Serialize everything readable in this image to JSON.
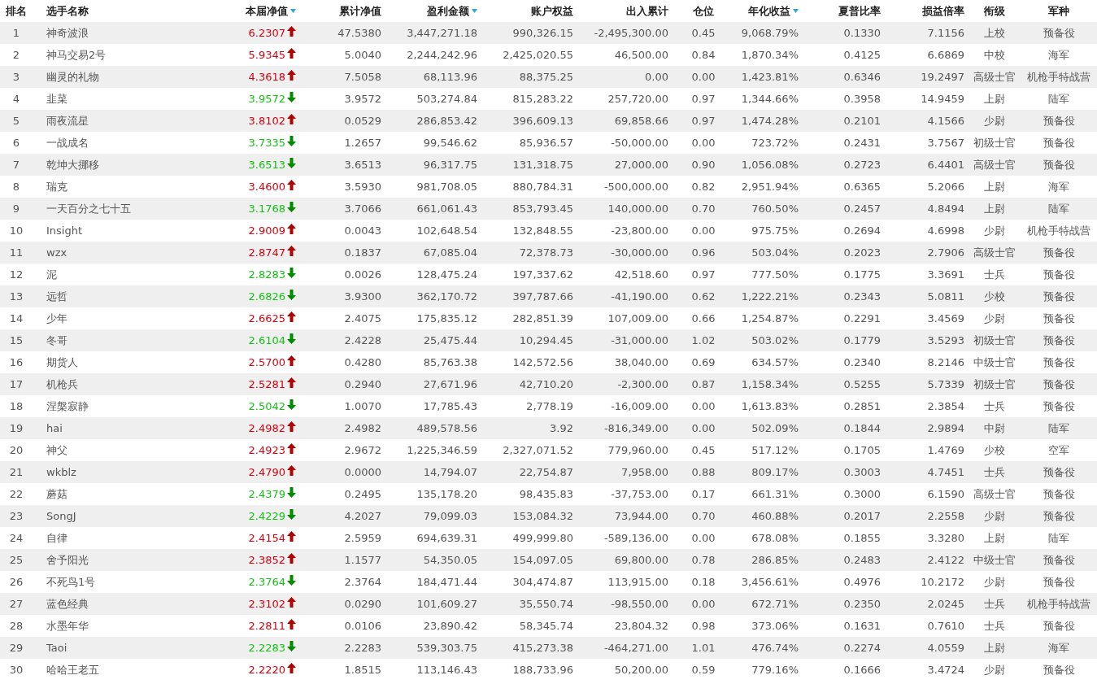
{
  "table": {
    "columns": [
      {
        "label": "排名",
        "sort_icon": false
      },
      {
        "label": "选手名称",
        "sort_icon": false
      },
      {
        "label": "本届净值",
        "sort_icon": true
      },
      {
        "label": "累计净值",
        "sort_icon": false
      },
      {
        "label": "盈利金额",
        "sort_icon": true
      },
      {
        "label": "账户权益",
        "sort_icon": false
      },
      {
        "label": "出入累计",
        "sort_icon": false
      },
      {
        "label": "仓位",
        "sort_icon": false
      },
      {
        "label": "年化收益",
        "sort_icon": true
      },
      {
        "label": "夏普比率",
        "sort_icon": false
      },
      {
        "label": "损益倍率",
        "sort_icon": false
      },
      {
        "label": "衔级",
        "sort_icon": false
      },
      {
        "label": "军种",
        "sort_icon": false
      }
    ],
    "rows": [
      {
        "cells": [
          "1",
          "神奇波浪",
          "6.2307",
          "47.5380",
          "3,447,271.18",
          "990,326.15",
          "-2,495,300.00",
          "0.45",
          "9,068.79%",
          "0.1330",
          "7.1156",
          "上校",
          "预备役"
        ],
        "rising": true
      },
      {
        "cells": [
          "2",
          "神马交易2号",
          "5.9345",
          "5.0040",
          "2,244,242.96",
          "2,425,020.55",
          "46,500.00",
          "0.84",
          "1,870.34%",
          "0.4125",
          "6.6869",
          "中校",
          "海军"
        ],
        "rising": true
      },
      {
        "cells": [
          "3",
          "幽灵的礼物",
          "4.3618",
          "7.5058",
          "68,113.96",
          "88,375.25",
          "0.00",
          "0.00",
          "1,423.81%",
          "0.6346",
          "19.2497",
          "高级士官",
          "机枪手特战营"
        ],
        "rising": true
      },
      {
        "cells": [
          "4",
          "韭菜",
          "3.9572",
          "3.9572",
          "503,274.84",
          "815,283.22",
          "257,720.00",
          "0.97",
          "1,344.66%",
          "0.3958",
          "14.9459",
          "上尉",
          "陆军"
        ],
        "rising": false
      },
      {
        "cells": [
          "5",
          "雨夜流星",
          "3.8102",
          "0.0529",
          "286,853.42",
          "396,609.13",
          "69,858.66",
          "0.97",
          "1,474.28%",
          "0.2101",
          "4.1566",
          "少尉",
          "预备役"
        ],
        "rising": true
      },
      {
        "cells": [
          "6",
          "一战成名",
          "3.7335",
          "1.2657",
          "99,546.62",
          "85,936.57",
          "-50,000.00",
          "0.00",
          "723.72%",
          "0.2431",
          "3.7567",
          "初级士官",
          "预备役"
        ],
        "rising": false
      },
      {
        "cells": [
          "7",
          "乾坤大挪移",
          "3.6513",
          "3.6513",
          "96,317.75",
          "131,318.75",
          "27,000.00",
          "0.90",
          "1,056.08%",
          "0.2723",
          "6.4401",
          "高级士官",
          "预备役"
        ],
        "rising": false
      },
      {
        "cells": [
          "8",
          "瑞克",
          "3.4600",
          "3.5930",
          "981,708.05",
          "880,784.31",
          "-500,000.00",
          "0.82",
          "2,951.94%",
          "0.6365",
          "5.2066",
          "上尉",
          "海军"
        ],
        "rising": true
      },
      {
        "cells": [
          "9",
          "一天百分之七十五",
          "3.1768",
          "3.7066",
          "661,061.43",
          "853,793.45",
          "140,000.00",
          "0.70",
          "760.50%",
          "0.2457",
          "4.8494",
          "上尉",
          "陆军"
        ],
        "rising": false
      },
      {
        "cells": [
          "10",
          "Insight",
          "2.9009",
          "0.0043",
          "102,648.54",
          "132,848.55",
          "-23,800.00",
          "0.00",
          "975.75%",
          "0.2694",
          "4.6998",
          "少尉",
          "机枪手特战营"
        ],
        "rising": true
      },
      {
        "cells": [
          "11",
          "wzx",
          "2.8747",
          "0.1837",
          "67,085.04",
          "72,378.73",
          "-30,000.00",
          "0.96",
          "503.04%",
          "0.2023",
          "2.7906",
          "高级士官",
          "预备役"
        ],
        "rising": true
      },
      {
        "cells": [
          "12",
          "泥",
          "2.8283",
          "0.0026",
          "128,475.24",
          "197,337.62",
          "42,518.60",
          "0.97",
          "777.50%",
          "0.1775",
          "3.3691",
          "士兵",
          "预备役"
        ],
        "rising": false
      },
      {
        "cells": [
          "13",
          "远哲",
          "2.6826",
          "3.9300",
          "362,170.72",
          "397,787.66",
          "-41,190.00",
          "0.62",
          "1,222.21%",
          "0.2343",
          "5.0811",
          "少校",
          "预备役"
        ],
        "rising": false
      },
      {
        "cells": [
          "14",
          "少年",
          "2.6625",
          "2.4075",
          "175,835.12",
          "282,851.39",
          "107,009.00",
          "0.66",
          "1,254.87%",
          "0.2291",
          "3.4569",
          "少尉",
          "预备役"
        ],
        "rising": true
      },
      {
        "cells": [
          "15",
          "冬哥",
          "2.6104",
          "2.4228",
          "25,475.44",
          "10,294.45",
          "-31,000.00",
          "1.02",
          "503.02%",
          "0.1779",
          "3.5293",
          "初级士官",
          "预备役"
        ],
        "rising": false
      },
      {
        "cells": [
          "16",
          "期货人",
          "2.5700",
          "0.4280",
          "85,763.38",
          "142,572.56",
          "38,040.00",
          "0.69",
          "634.57%",
          "0.2340",
          "8.2146",
          "中级士官",
          "预备役"
        ],
        "rising": true
      },
      {
        "cells": [
          "17",
          "机枪兵",
          "2.5281",
          "0.2940",
          "27,671.96",
          "42,710.20",
          "-2,300.00",
          "0.87",
          "1,158.34%",
          "0.5255",
          "5.7339",
          "初级士官",
          "预备役"
        ],
        "rising": true
      },
      {
        "cells": [
          "18",
          "涅槃寂静",
          "2.5042",
          "1.0070",
          "17,785.43",
          "2,778.19",
          "-16,009.00",
          "0.00",
          "1,613.83%",
          "0.2851",
          "2.3854",
          "士兵",
          "预备役"
        ],
        "rising": false
      },
      {
        "cells": [
          "19",
          "hai",
          "2.4982",
          "2.4982",
          "489,578.56",
          "3.92",
          "-816,349.00",
          "0.00",
          "502.09%",
          "0.1844",
          "2.9894",
          "中尉",
          "陆军"
        ],
        "rising": true
      },
      {
        "cells": [
          "20",
          "神父",
          "2.4923",
          "2.9672",
          "1,225,346.59",
          "2,327,071.52",
          "779,960.00",
          "0.45",
          "517.12%",
          "0.1705",
          "1.4769",
          "少校",
          "空军"
        ],
        "rising": true
      },
      {
        "cells": [
          "21",
          "wkblz",
          "2.4790",
          "0.0000",
          "14,794.07",
          "22,754.87",
          "7,958.00",
          "0.88",
          "809.17%",
          "0.3003",
          "4.7451",
          "士兵",
          "预备役"
        ],
        "rising": true
      },
      {
        "cells": [
          "22",
          "蘑菇",
          "2.4379",
          "0.2495",
          "135,178.20",
          "98,435.83",
          "-37,753.00",
          "0.17",
          "661.31%",
          "0.3000",
          "6.1590",
          "高级士官",
          "预备役"
        ],
        "rising": false
      },
      {
        "cells": [
          "23",
          "SongJ",
          "2.4229",
          "4.2027",
          "79,099.03",
          "153,084.32",
          "73,944.00",
          "0.70",
          "460.88%",
          "0.2017",
          "2.2558",
          "少尉",
          "预备役"
        ],
        "rising": false
      },
      {
        "cells": [
          "24",
          "自律",
          "2.4154",
          "2.5959",
          "694,639.31",
          "499,999.80",
          "-589,136.00",
          "0.00",
          "678.08%",
          "0.1855",
          "3.3280",
          "上尉",
          "陆军"
        ],
        "rising": true
      },
      {
        "cells": [
          "25",
          "舍予阳光",
          "2.3852",
          "1.1577",
          "54,350.05",
          "154,097.05",
          "69,800.00",
          "0.78",
          "286.85%",
          "0.2483",
          "2.4122",
          "中级士官",
          "预备役"
        ],
        "rising": true
      },
      {
        "cells": [
          "26",
          "不死鸟1号",
          "2.3764",
          "2.3764",
          "184,471.44",
          "304,474.87",
          "113,915.00",
          "0.18",
          "3,456.61%",
          "0.4976",
          "10.2172",
          "少尉",
          "预备役"
        ],
        "rising": false
      },
      {
        "cells": [
          "27",
          "蓝色经典",
          "2.3102",
          "0.0290",
          "101,609.27",
          "35,550.74",
          "-98,550.00",
          "0.00",
          "672.71%",
          "0.2350",
          "2.0245",
          "士兵",
          "机枪手特战营"
        ],
        "rising": true
      },
      {
        "cells": [
          "28",
          "水墨年华",
          "2.2811",
          "0.0106",
          "23,890.42",
          "58,345.74",
          "23,804.32",
          "0.98",
          "373.06%",
          "0.1631",
          "0.7610",
          "士兵",
          "预备役"
        ],
        "rising": true
      },
      {
        "cells": [
          "29",
          "Taoi",
          "2.2283",
          "2.2283",
          "539,303.75",
          "415,273.38",
          "-464,271.00",
          "1.01",
          "476.74%",
          "0.2274",
          "4.0559",
          "上尉",
          "海军"
        ],
        "rising": false
      },
      {
        "cells": [
          "30",
          "哈哈王老五",
          "2.2220",
          "1.8515",
          "113,146.43",
          "188,733.96",
          "50,200.00",
          "0.59",
          "779.16%",
          "0.1666",
          "3.4724",
          "少尉",
          "预备役"
        ],
        "rising": true
      }
    ]
  }
}
